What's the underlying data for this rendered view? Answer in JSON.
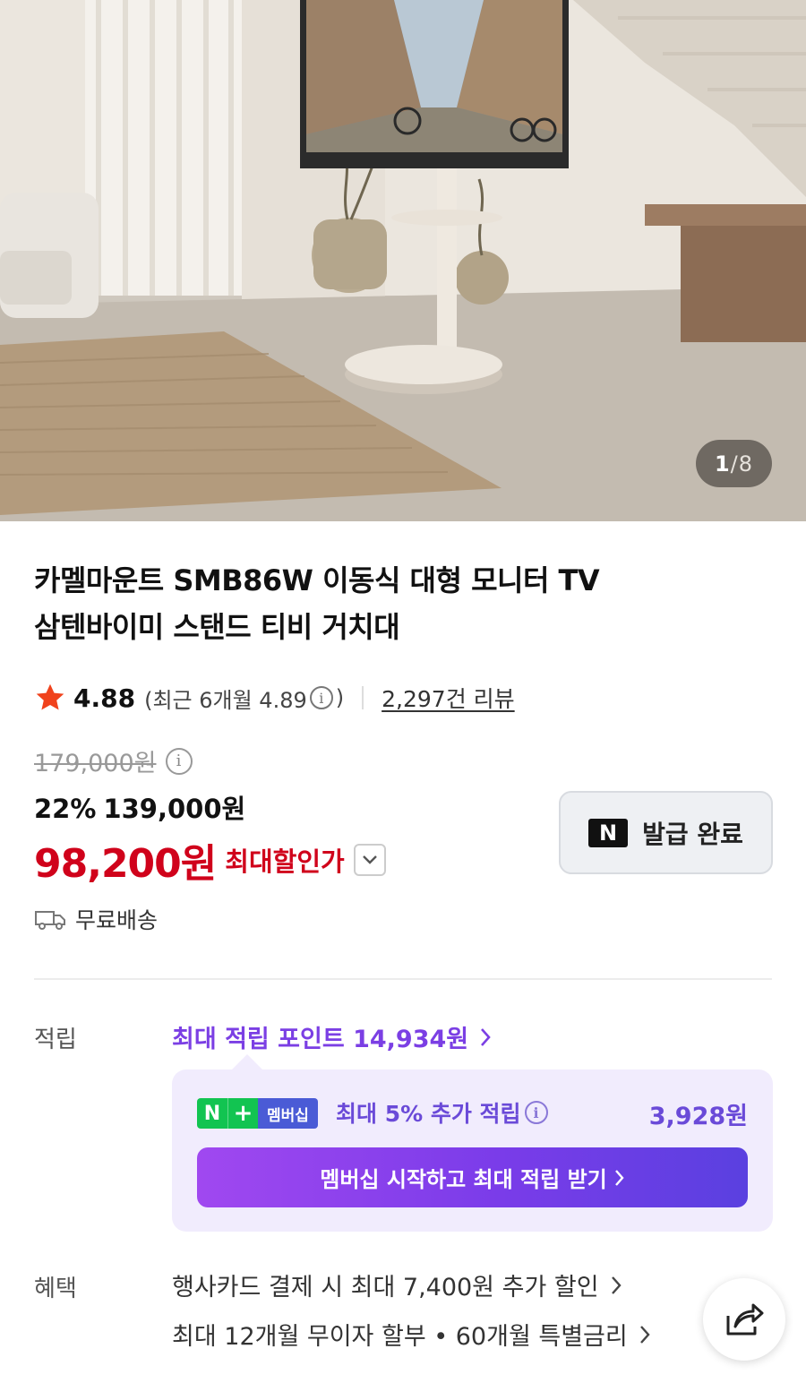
{
  "hero": {
    "counter_current": "1",
    "counter_sep": "/",
    "counter_total": "8"
  },
  "product": {
    "title_line1": "카멜마운트 SMB86W 이동식 대형 모니터 TV",
    "title_line2": "삼텐바이미 스탠드 티비 거치대",
    "rating": "4.88",
    "rating_recent_open": "(최근 6개월 4.89",
    "rating_recent_close": ")",
    "info_glyph": "i",
    "reviews": "2,297건 리뷰",
    "original_price": "179,000원",
    "discount_pct": "22%",
    "sale_price": "139,000원",
    "final_price": "98,200원",
    "final_label": "최대할인가",
    "coupon_badge": "N",
    "coupon_label": "발급 완료",
    "shipping": "무료배송"
  },
  "points": {
    "label": "적립",
    "max_points": "최대 적립 포인트 14,934원",
    "membership_badge_n": "N",
    "membership_badge_plus": "+",
    "membership_badge_text": "멤버십",
    "membership_text": "최대 5% 추가 적립",
    "membership_amount": "3,928원",
    "cta": "멤버십 시작하고 최대 적립 받기"
  },
  "benefits": {
    "label": "혜택",
    "line1": "행사카드 결제 시 최대 7,400원 추가 할인",
    "line2": "최대 12개월 무이자 할부 • 60개월 특별금리"
  },
  "colors": {
    "price_red": "#d0021b",
    "purple": "#7b3fe4",
    "naver_green": "#12c451",
    "star": "#f0421c"
  },
  "icons": [
    "star-icon",
    "info-icon",
    "chevron-down-icon",
    "truck-icon",
    "chevron-right-icon",
    "share-icon"
  ]
}
